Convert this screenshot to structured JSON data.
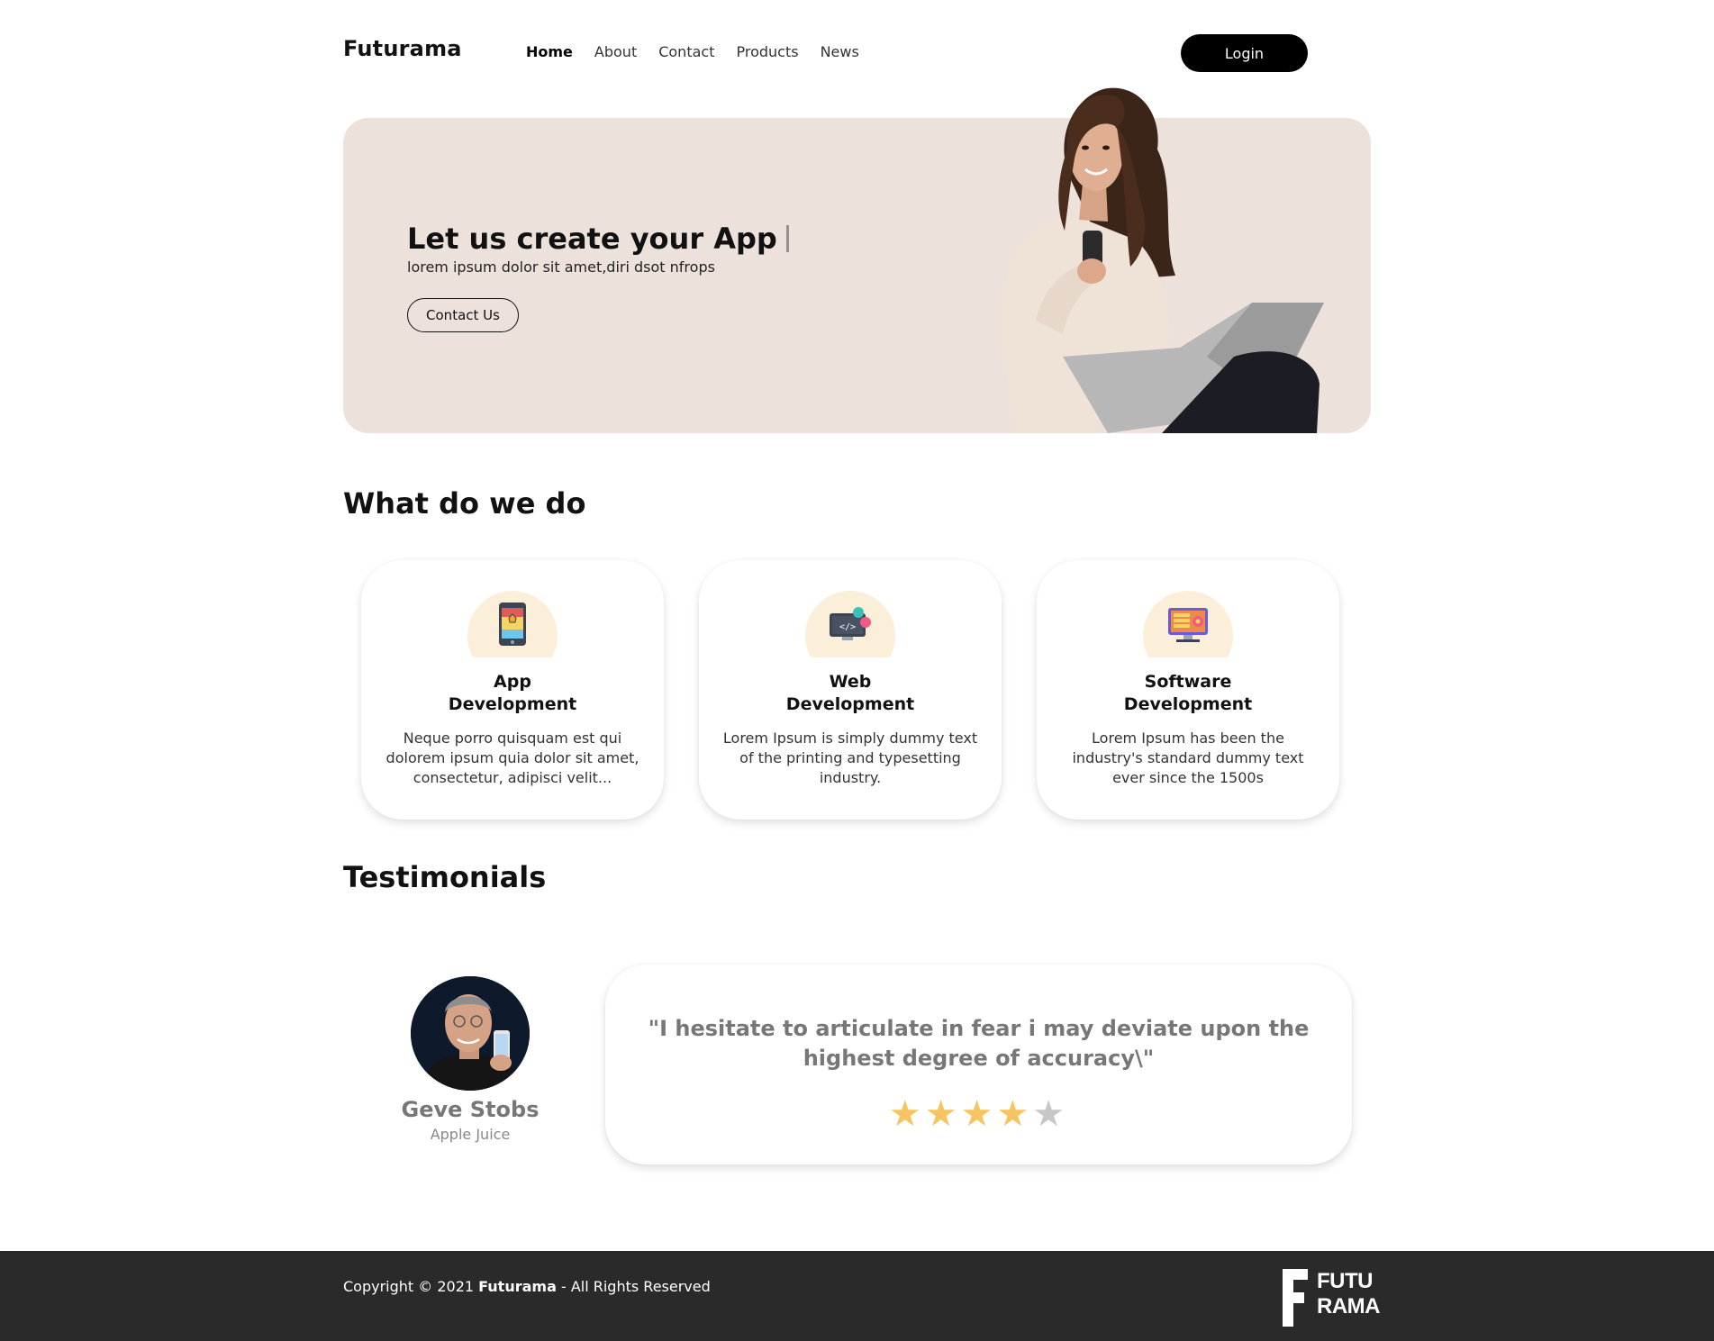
{
  "brand": {
    "name": "Futurama"
  },
  "nav": {
    "items": [
      {
        "label": "Home"
      },
      {
        "label": "About"
      },
      {
        "label": "Contact"
      },
      {
        "label": "Products"
      },
      {
        "label": "News"
      }
    ],
    "login_label": "Login"
  },
  "hero": {
    "title": "Let us create your App",
    "subtitle": "lorem ipsum dolor sit amet,diri dsot nfrops",
    "cta_label": "Contact Us",
    "background_color": "#ede1dc"
  },
  "services": {
    "title": "What do we do",
    "cards": [
      {
        "title": "App Development",
        "description": "Neque porro quisquam est qui dolorem ipsum quia dolor sit amet, consectetur, adipisci velit...",
        "icon": "mobile-app-icon"
      },
      {
        "title": "Web Development",
        "description": "Lorem Ipsum is simply dummy text of the printing and typesetting industry.",
        "icon": "web-code-icon"
      },
      {
        "title": "Software Development",
        "description": "Lorem Ipsum has been the industry's standard dummy text ever since the 1500s",
        "icon": "desktop-software-icon"
      }
    ]
  },
  "testimonials": {
    "title": "Testimonials",
    "name": "Geve Stobs",
    "role": "Apple Juice",
    "quote": "\"I hesitate to articulate in fear i may deviate upon the highest degree of accuracy\\\"",
    "rating": 4,
    "rating_max": 5,
    "star_color": "#f7c462"
  },
  "footer": {
    "copyright_prefix": "Copyright © 2021 ",
    "copyright_brand": "Futurama",
    "copyright_suffix": " - All Rights Reserved",
    "logo_line1": "FUTU",
    "logo_line2": "RAMA",
    "background_color": "#2a2a2a"
  }
}
